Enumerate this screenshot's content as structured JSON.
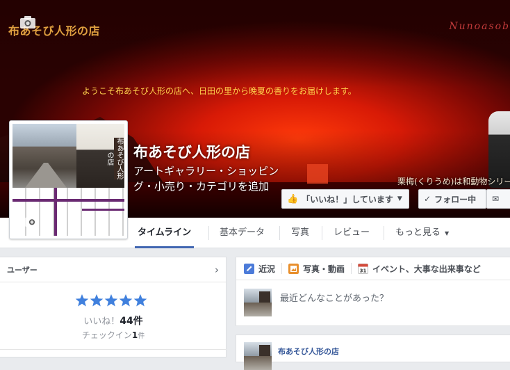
{
  "cover": {
    "brand_text": "布あそび人形の店",
    "script_text": "Nunoasob",
    "tagline": "ようこそ布あそび人形の店へ、日田の里から晩夏の香りをお届けします。",
    "caption": "栗梅(くりうめ)は和動物シリー"
  },
  "page": {
    "name": "布あそび人形の店",
    "category": "アートギャラリー・ショッピング・小売り・カテゴリを追加",
    "profile_sign": "布あそび人形の店"
  },
  "actions": {
    "like_label": "「いいね！」しています",
    "follow_label": "フォロー中"
  },
  "tabs": [
    {
      "label": "タイムライン"
    },
    {
      "label": "基本データ"
    },
    {
      "label": "写真"
    },
    {
      "label": "レビュー"
    },
    {
      "label": "もっと見る"
    }
  ],
  "sidebar": {
    "title": "ユーザー",
    "rating": 5,
    "likes_prefix": "いいね！",
    "likes_count": "44件",
    "checkin_prefix": "チェックイン",
    "checkin_count": "1",
    "checkin_unit": "件"
  },
  "composer": {
    "tabs": [
      {
        "label": "近況",
        "icon": "pencil-icon"
      },
      {
        "label": "写真・動画",
        "icon": "photo-icon"
      },
      {
        "label": "イベント、大事な出来事など",
        "icon": "calendar-icon",
        "icon_text": "31"
      }
    ],
    "placeholder": "最近どんなことがあった？"
  },
  "post": {
    "author": "布あそび人形の店"
  },
  "colors": {
    "accent": "#4267b2",
    "star": "#4080dd",
    "link": "#365899"
  }
}
